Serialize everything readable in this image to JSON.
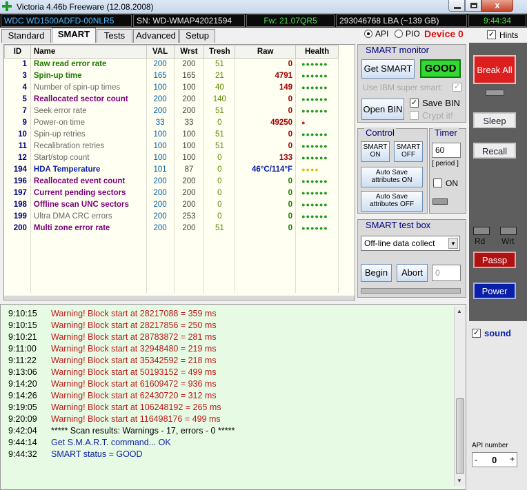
{
  "window": {
    "title": "Victoria 4.46b Freeware (12.08.2008)",
    "close_glyph": "x"
  },
  "info": {
    "model": "WDC WD1500ADFD-00NLR5",
    "serial": "SN: WD-WMAP42021594",
    "firmware": "Fw: 21.07QR5",
    "lba": "293046768 LBA (~139 GB)",
    "time": "9:44:34"
  },
  "tabs": [
    "Standard",
    "SMART",
    "Tests",
    "Advanced",
    "Setup"
  ],
  "mode": {
    "api": "API",
    "pio": "PIO",
    "device": "Device 0",
    "hints": "Hints"
  },
  "smart_table": {
    "headers": [
      "ID",
      "Name",
      "VAL",
      "Wrst",
      "Tresh",
      "Raw",
      "Health"
    ],
    "rows": [
      {
        "id": "1",
        "name": "Raw read error rate",
        "val": "200",
        "wrst": "200",
        "tresh": "51",
        "raw": "0",
        "health": "●●●●●●",
        "name_color": "#1c7a00",
        "raw_color": "#a00000",
        "health_color": "#1c9a1c",
        "bold": true
      },
      {
        "id": "3",
        "name": "Spin-up time",
        "val": "165",
        "wrst": "165",
        "tresh": "21",
        "raw": "4791",
        "health": "●●●●●●",
        "name_color": "#1c7a00",
        "raw_color": "#a00000",
        "health_color": "#1c9a1c",
        "bold": true
      },
      {
        "id": "4",
        "name": "Number of spin-up times",
        "val": "100",
        "wrst": "100",
        "tresh": "40",
        "raw": "149",
        "health": "●●●●●●",
        "name_color": "#6a6a6a",
        "raw_color": "#a00000",
        "health_color": "#1c9a1c",
        "bold": false
      },
      {
        "id": "5",
        "name": "Reallocated sector count",
        "val": "200",
        "wrst": "200",
        "tresh": "140",
        "raw": "0",
        "health": "●●●●●●",
        "name_color": "#7a007a",
        "raw_color": "#a00000",
        "health_color": "#1c9a1c",
        "bold": true
      },
      {
        "id": "7",
        "name": "Seek error rate",
        "val": "200",
        "wrst": "200",
        "tresh": "51",
        "raw": "0",
        "health": "●●●●●●",
        "name_color": "#6a6a6a",
        "raw_color": "#a00000",
        "health_color": "#1c9a1c",
        "bold": false
      },
      {
        "id": "9",
        "name": "Power-on time",
        "val": "33",
        "wrst": "33",
        "tresh": "0",
        "raw": "49250",
        "health": "●",
        "name_color": "#6a6a6a",
        "raw_color": "#a00000",
        "health_color": "#e01010",
        "bold": false
      },
      {
        "id": "10",
        "name": "Spin-up retries",
        "val": "100",
        "wrst": "100",
        "tresh": "51",
        "raw": "0",
        "health": "●●●●●●",
        "name_color": "#6a6a6a",
        "raw_color": "#a00000",
        "health_color": "#1c9a1c",
        "bold": false
      },
      {
        "id": "11",
        "name": "Recalibration retries",
        "val": "100",
        "wrst": "100",
        "tresh": "51",
        "raw": "0",
        "health": "●●●●●●",
        "name_color": "#6a6a6a",
        "raw_color": "#a00000",
        "health_color": "#1c9a1c",
        "bold": false
      },
      {
        "id": "12",
        "name": "Start/stop count",
        "val": "100",
        "wrst": "100",
        "tresh": "0",
        "raw": "133",
        "health": "●●●●●●",
        "name_color": "#6a6a6a",
        "raw_color": "#a00000",
        "health_color": "#1c9a1c",
        "bold": false
      },
      {
        "id": "194",
        "name": "HDA Temperature",
        "val": "101",
        "wrst": "87",
        "tresh": "0",
        "raw": "46°C/114°F",
        "health": "●●●●",
        "name_color": "#0a1fa8",
        "raw_color": "#0a1fa8",
        "health_color": "#e0c010",
        "bold": true
      },
      {
        "id": "196",
        "name": "Reallocated event count",
        "val": "200",
        "wrst": "200",
        "tresh": "0",
        "raw": "0",
        "health": "●●●●●●",
        "name_color": "#7a007a",
        "raw_color": "#1c7a00",
        "health_color": "#1c9a1c",
        "bold": true
      },
      {
        "id": "197",
        "name": "Current pending sectors",
        "val": "200",
        "wrst": "200",
        "tresh": "0",
        "raw": "0",
        "health": "●●●●●●",
        "name_color": "#7a007a",
        "raw_color": "#1c7a00",
        "health_color": "#1c9a1c",
        "bold": true
      },
      {
        "id": "198",
        "name": "Offline scan UNC sectors",
        "val": "200",
        "wrst": "200",
        "tresh": "0",
        "raw": "0",
        "health": "●●●●●●",
        "name_color": "#7a007a",
        "raw_color": "#1c7a00",
        "health_color": "#1c9a1c",
        "bold": true
      },
      {
        "id": "199",
        "name": "Ultra DMA CRC errors",
        "val": "200",
        "wrst": "253",
        "tresh": "0",
        "raw": "0",
        "health": "●●●●●●",
        "name_color": "#6a6a6a",
        "raw_color": "#1c7a00",
        "health_color": "#1c9a1c",
        "bold": false
      },
      {
        "id": "200",
        "name": "Multi zone error rate",
        "val": "200",
        "wrst": "200",
        "tresh": "51",
        "raw": "0",
        "health": "●●●●●●",
        "name_color": "#7a007a",
        "raw_color": "#1c7a00",
        "health_color": "#1c9a1c",
        "bold": true
      }
    ]
  },
  "smart_monitor": {
    "title": "SMART monitor",
    "get_smart": "Get SMART",
    "status": "GOOD",
    "ibm_label": "Use IBM super smart:",
    "open_bin": "Open BIN",
    "save_bin": "Save BIN",
    "crypt": "Crypt it!"
  },
  "control": {
    "title": "Control",
    "smart_on": "SMART ON",
    "smart_off": "SMART OFF",
    "autosave_on": "Auto Save attributes ON",
    "autosave_off": "Auto Save attributes OFF"
  },
  "timer": {
    "title": "Timer",
    "value": "60",
    "period": "[ period ]",
    "on_label": "ON"
  },
  "test_box": {
    "title": "SMART test box",
    "selected": "Off-line data collect",
    "begin": "Begin",
    "abort": "Abort",
    "value": "0"
  },
  "side": {
    "break_all": "Break All",
    "sleep": "Sleep",
    "recall": "Recall",
    "rd": "Rd",
    "wrt": "Wrt",
    "passp": "Passp",
    "power": "Power",
    "sound": "sound",
    "api_number_label": "API number",
    "api_number": "0",
    "minus": "-",
    "plus": "+"
  },
  "log": [
    {
      "time": "9:10:15",
      "msg": "Warning! Block start at 28217088 = 359 ms",
      "type": "warn"
    },
    {
      "time": "9:10:15",
      "msg": "Warning! Block start at 28217856 = 250 ms",
      "type": "warn"
    },
    {
      "time": "9:10:21",
      "msg": "Warning! Block start at 28783872 = 281 ms",
      "type": "warn"
    },
    {
      "time": "9:11:00",
      "msg": "Warning! Block start at 32948480 = 219 ms",
      "type": "warn"
    },
    {
      "time": "9:11:22",
      "msg": "Warning! Block start at 35342592 = 218 ms",
      "type": "warn"
    },
    {
      "time": "9:13:06",
      "msg": "Warning! Block start at 50193152 = 499 ms",
      "type": "warn"
    },
    {
      "time": "9:14:20",
      "msg": "Warning! Block start at 61609472 = 936 ms",
      "type": "warn"
    },
    {
      "time": "9:14:26",
      "msg": "Warning! Block start at 62430720 = 312 ms",
      "type": "warn"
    },
    {
      "time": "9:19:05",
      "msg": "Warning! Block start at 106248192 = 265 ms",
      "type": "warn"
    },
    {
      "time": "9:20:09",
      "msg": "Warning! Block start at 116498176 = 499 ms",
      "type": "warn"
    },
    {
      "time": "9:42:04",
      "msg": "***** Scan results: Warnings - 17, errors - 0 *****",
      "type": "result"
    },
    {
      "time": "9:44:14",
      "msg": "Get S.M.A.R.T. command... OK",
      "type": "info"
    },
    {
      "time": "9:44:32",
      "msg": "SMART status = GOOD",
      "type": "info"
    }
  ],
  "colors": {
    "warn": "#c01818",
    "result": "#000000",
    "info": "#0a1fa8"
  }
}
